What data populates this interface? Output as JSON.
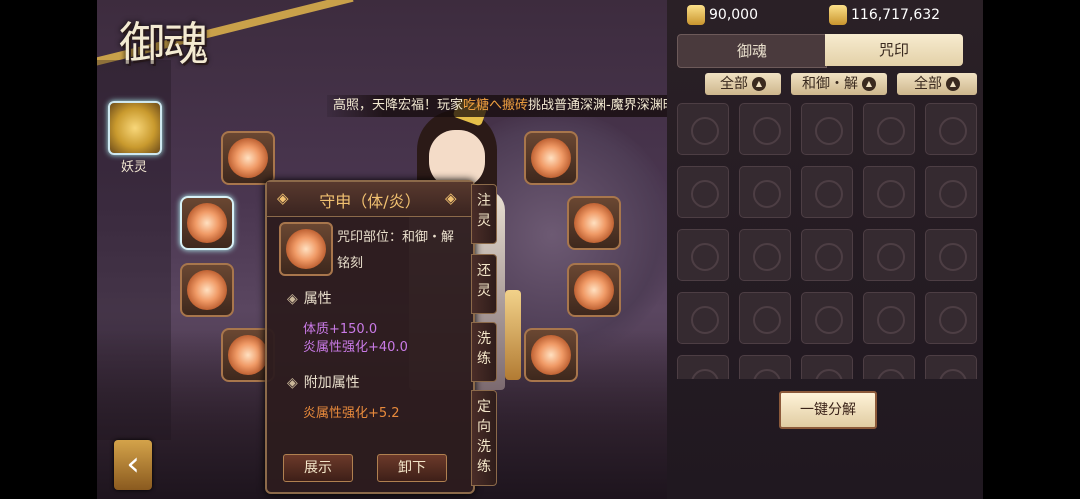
{
  "header": {
    "title": "御魂"
  },
  "currency": {
    "amount1": "90,000",
    "amount2": "116,717,632"
  },
  "tabs": {
    "yuhun": "御魂",
    "zhouyin": "咒印"
  },
  "filters": {
    "f1": "全部",
    "f2": "和御・解",
    "f3": "全部"
  },
  "sidebar": {
    "slot_label": "妖灵"
  },
  "ticker": {
    "part1": "高照，天降宏福！玩家",
    "player": "吃糖へ搬砖",
    "part2": "挑战普通深渊-魔界深渊时，竟然得到了"
  },
  "popup": {
    "title": "守申（体/炎）",
    "position_text": "咒印部位：和御・解",
    "engrave": "铭刻",
    "section_attr": "属性",
    "attr1": "体质+150.0",
    "attr2": "炎属性强化+40.0",
    "section_extra": "附加属性",
    "extra1": "炎属性强化+5.2",
    "btn_show": "展示",
    "btn_remove": "卸下"
  },
  "side_actions": {
    "a1": "注灵",
    "a2": "还灵",
    "a3": "洗练",
    "a4": "定向洗练"
  },
  "decompose_button": "一键分解",
  "icons": {
    "back": "back-arrow-icon",
    "coin": "coin-icon"
  }
}
